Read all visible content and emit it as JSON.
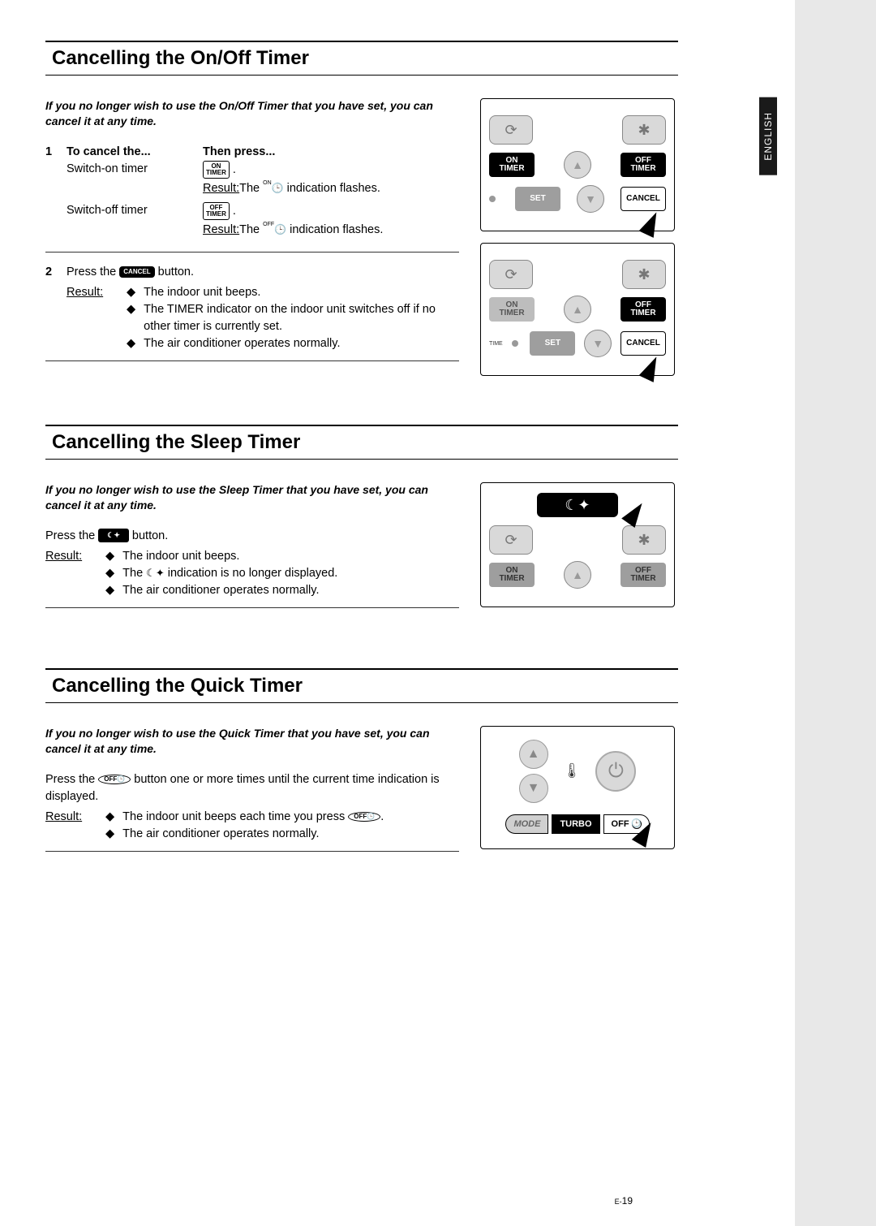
{
  "language_tab": "ENGLISH",
  "page_number_prefix": "E-",
  "page_number": "19",
  "sections": {
    "onoff": {
      "title": "Cancelling the On/Off Timer",
      "intro": "If you no longer wish to use the On/Off Timer that you have set, you can cancel it at any time.",
      "step1_num": "1",
      "col1_header": "To cancel the...",
      "col2_header": "Then press...",
      "row1_label": "Switch-on timer",
      "row1_btn": "ON\nTIMER",
      "row1_result_prefix": "Result:",
      "row1_result_text_a": "The ",
      "row1_sup": "ON",
      "row1_result_text_b": " indication flashes.",
      "row2_label": "Switch-off timer",
      "row2_btn": "OFF\nTIMER",
      "row2_result_prefix": "Result:",
      "row2_result_text_a": "The ",
      "row2_sup": "OFF",
      "row2_result_text_b": " indication flashes.",
      "step2_num": "2",
      "step2_text_a": "Press the ",
      "step2_btn": "CANCEL",
      "step2_text_b": " button.",
      "step2_result_label": "Result:",
      "step2_b1": "The indoor unit beeps.",
      "step2_b2": "The TIMER indicator on the indoor unit switches off if no other timer is currently set.",
      "step2_b3": "The air conditioner operates normally.",
      "remote_on_timer": "ON\nTIMER",
      "remote_off_timer": "OFF\nTIMER",
      "remote_set": "SET",
      "remote_cancel": "CANCEL",
      "remote_time": "TIME"
    },
    "sleep": {
      "title": "Cancelling the Sleep Timer",
      "intro": "If you no longer wish to use the Sleep Timer that you have set, you can cancel it at any time.",
      "line1_a": "Press the ",
      "line1_b": " button.",
      "result_label": "Result:",
      "b1": "The indoor unit beeps.",
      "b2a": "The ",
      "b2b": " indication is no longer displayed.",
      "b3": "The air conditioner operates normally.",
      "remote_on_timer": "ON\nTIMER",
      "remote_off_timer": "OFF\nTIMER"
    },
    "quick": {
      "title": "Cancelling the Quick Timer",
      "intro": "If you no longer wish to use the Quick Timer that you have set, you can cancel it at any time.",
      "line1_a": "Press the ",
      "line1_b": " button one or more times until the current time indication is displayed.",
      "result_label": "Result:",
      "b1a": "The indoor unit beeps each time you press ",
      "b1b": ".",
      "b2": "The air conditioner operates normally.",
      "remote_mode": "MODE",
      "remote_turbo": "TURBO",
      "remote_off": "OFF",
      "off_btn_label": "OFF"
    }
  }
}
